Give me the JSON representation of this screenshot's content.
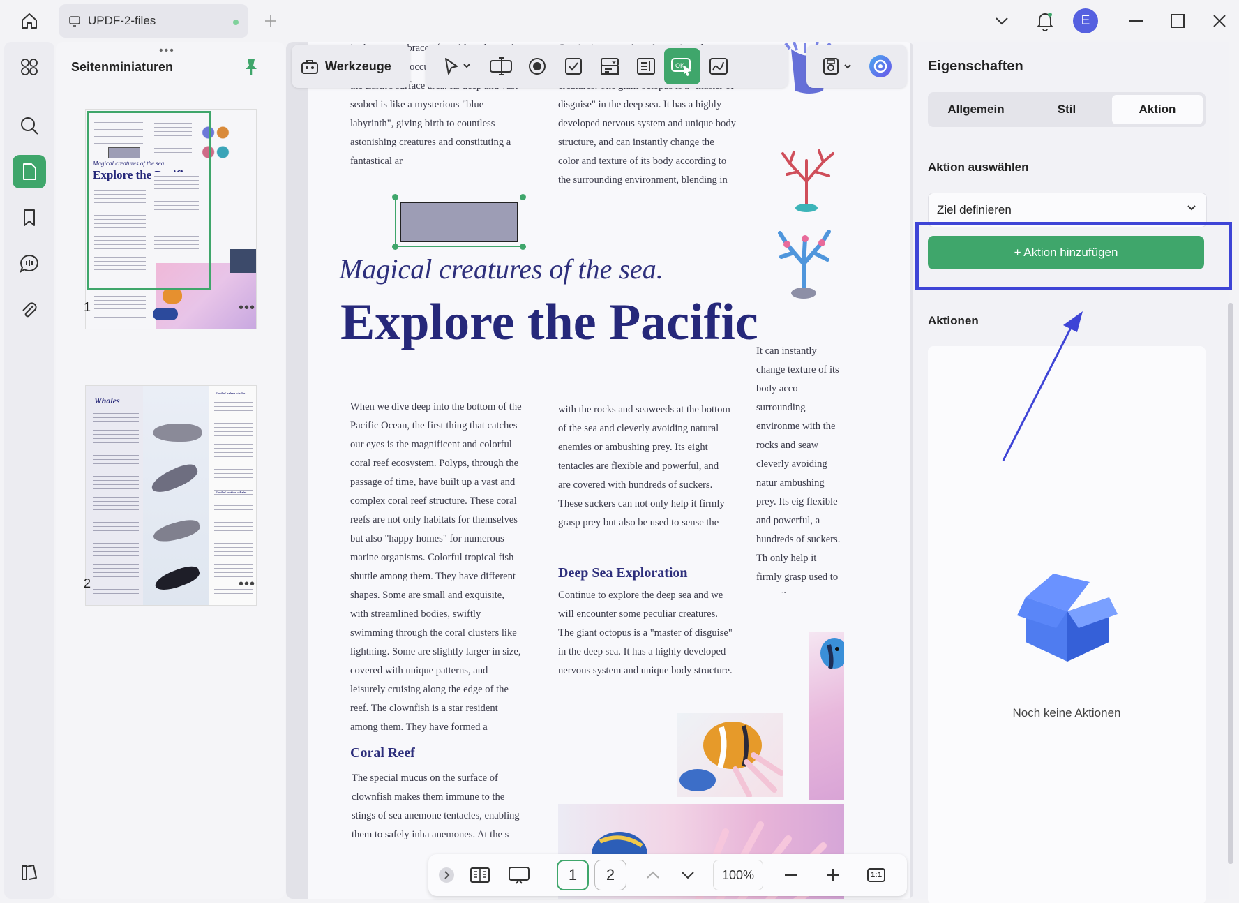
{
  "titlebar": {
    "tab_title": "UPDF-2-files",
    "avatar_initial": "E"
  },
  "thumbnails": {
    "title": "Seitenminiaturen",
    "pages": [
      {
        "number": "1"
      },
      {
        "number": "2"
      }
    ],
    "page1": {
      "subtitle": "Magical creatures of the sea.",
      "title": "Explore the Pacific",
      "deep_sea": "Deep Sea Exploration",
      "coral": "Coral Reef"
    },
    "page2": {
      "title": "Whales",
      "side_h1": "Food of baleen whales",
      "side_h2": "Food of toothed whales"
    }
  },
  "toolbar": {
    "tools_label": "Werkzeuge",
    "active_tool": "button-form-field"
  },
  "document": {
    "col1_top": "in the vast embrace of our blue planet, the Pacific Ocean occupies about one-third of the Earth's surface area. Its deep and vast seabed is like a mysterious \"blue labyrinth\", giving birth to countless astonishing creatures and constituting a fantastical ar",
    "col2_top": "Continuing to explore deeper into the ocean, we will encounter some peculiar creatures. The giant octopus is a \"master of disguise\" in the deep sea. It has a highly developed nervous system and unique body structure, and can instantly change the color and texture of its body according to the surrounding environment, blending in",
    "subtitle": "Magical creatures of the sea.",
    "title": "Explore the Pacific",
    "col3_text": "It can instantly change texture of its body acco surrounding environme with the rocks and seaw cleverly avoiding natur ambushing prey. Its eig flexible and powerful, a hundreds of suckers. Th only help it firmly grasp used to sense the surrou environment.",
    "col1_body": "When we dive deep into the bottom of the Pacific Ocean, the first thing that catches our eyes is the magnificent and colorful coral reef ecosystem. Polyps, through the passage of time, have built up a vast and complex coral reef structure. These coral reefs are not only habitats for themselves but also \"happy homes\" for numerous marine organisms. Colorful tropical fish shuttle among them. They have different shapes. Some are small and exquisite, with streamlined bodies, swiftly swimming through the coral clusters like lightning. Some are slightly larger in size, covered with unique patterns, and leisurely cruising along the edge of the reef. The clownfish is a star resident among them. They have formed a wonderful symbiotic relationship with sea anemones.",
    "col2_body": "with the rocks and seaweeds at the bottom of the sea and cleverly avoiding natural enemies or ambushing prey. Its eight tentacles are flexible and powerful, and are covered with hundreds of suckers. These suckers can not only help it firmly grasp prey but also be used to sense the surrounding environment.",
    "deep_sea_heading": "Deep Sea Exploration",
    "deep_sea_body": "Continue to explore the deep sea and we will encounter some peculiar creatures. The giant octopus is a \"master of disguise\" in the deep sea. It has a highly developed nervous system and unique body structure.",
    "coral_heading": "Coral Reef",
    "coral_body": "The special mucus on the surface of clownfish makes them immune to the stings of sea anemone tentacles, enabling them to safely inha anemones. At the s"
  },
  "bottombar": {
    "page_1": "1",
    "page_2": "2",
    "zoom": "100%",
    "fit_label": "1:1"
  },
  "properties": {
    "title": "Eigenschaften",
    "tabs": [
      "Allgemein",
      "Stil",
      "Aktion"
    ],
    "active_tab": "Aktion",
    "select_action_label": "Aktion auswählen",
    "select_value": "Ziel definieren",
    "add_action_label": "+ Aktion hinzufügen",
    "actions_label": "Aktionen",
    "empty_label": "Noch keine Aktionen"
  },
  "colors": {
    "accent_green": "#3fa66b",
    "highlight_blue": "#3e44d6",
    "title_navy": "#26287a"
  }
}
